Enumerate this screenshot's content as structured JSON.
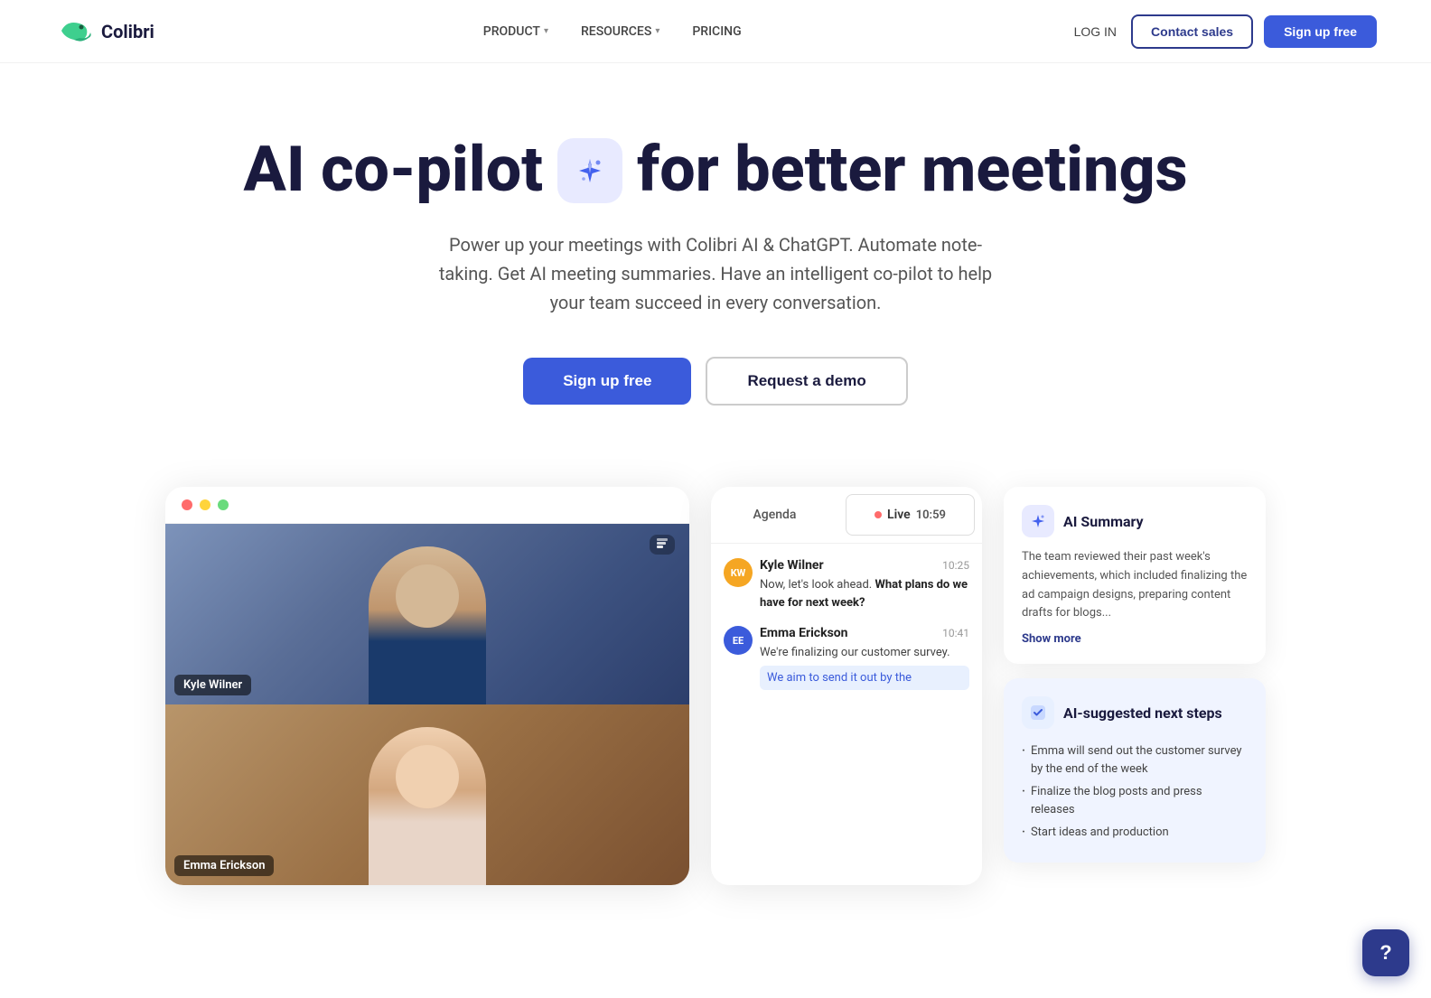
{
  "brand": {
    "name": "Colibri",
    "logo_color": "#3ecf8e"
  },
  "nav": {
    "product_label": "PRODUCT",
    "resources_label": "RESOURCES",
    "pricing_label": "PRICING",
    "login_label": "LOG IN",
    "contact_sales_label": "Contact sales",
    "signup_label": "Sign up free"
  },
  "hero": {
    "title_part1": "AI co-pilot",
    "title_part2": "for better meetings",
    "subtitle": "Power up your meetings with Colibri AI & ChatGPT. Automate note-taking. Get AI meeting summaries. Have an intelligent co-pilot to help your team succeed in every conversation.",
    "cta_primary": "Sign up free",
    "cta_secondary": "Request a demo"
  },
  "demo": {
    "header_dots": [
      "red",
      "yellow",
      "green"
    ],
    "participant1": {
      "name": "Kyle Wilner",
      "avatar_initials": "KW",
      "avatar_color": "#f5a623"
    },
    "participant2": {
      "name": "Emma Erickson",
      "avatar_initials": "EE",
      "avatar_color": "#3b5bdb"
    },
    "tabs": {
      "agenda": "Agenda",
      "live": "Live",
      "time": "10:59"
    },
    "messages": [
      {
        "sender": "Kyle Wilner",
        "initials": "KW",
        "time": "10:25",
        "text": "Now, let's look ahead. What plans do we have for next week?",
        "bold_range": "What plans do we have for next week?"
      },
      {
        "sender": "Emma Erickson",
        "initials": "EE",
        "time": "10:41",
        "text": "We're finalizing our customer survey.",
        "highlighted": "We aim to send it out by the"
      }
    ]
  },
  "ai_summary": {
    "title": "AI Summary",
    "text": "The team reviewed their past week's achievements, which included finalizing the ad campaign designs, preparing content drafts for blogs...",
    "show_more": "Show more"
  },
  "ai_next_steps": {
    "title": "AI-suggested next steps",
    "steps": [
      "Emma will send out the customer survey by the end of the week",
      "Finalize the blog posts and press releases",
      "Start ideas and production"
    ]
  },
  "help": {
    "label": "?"
  }
}
